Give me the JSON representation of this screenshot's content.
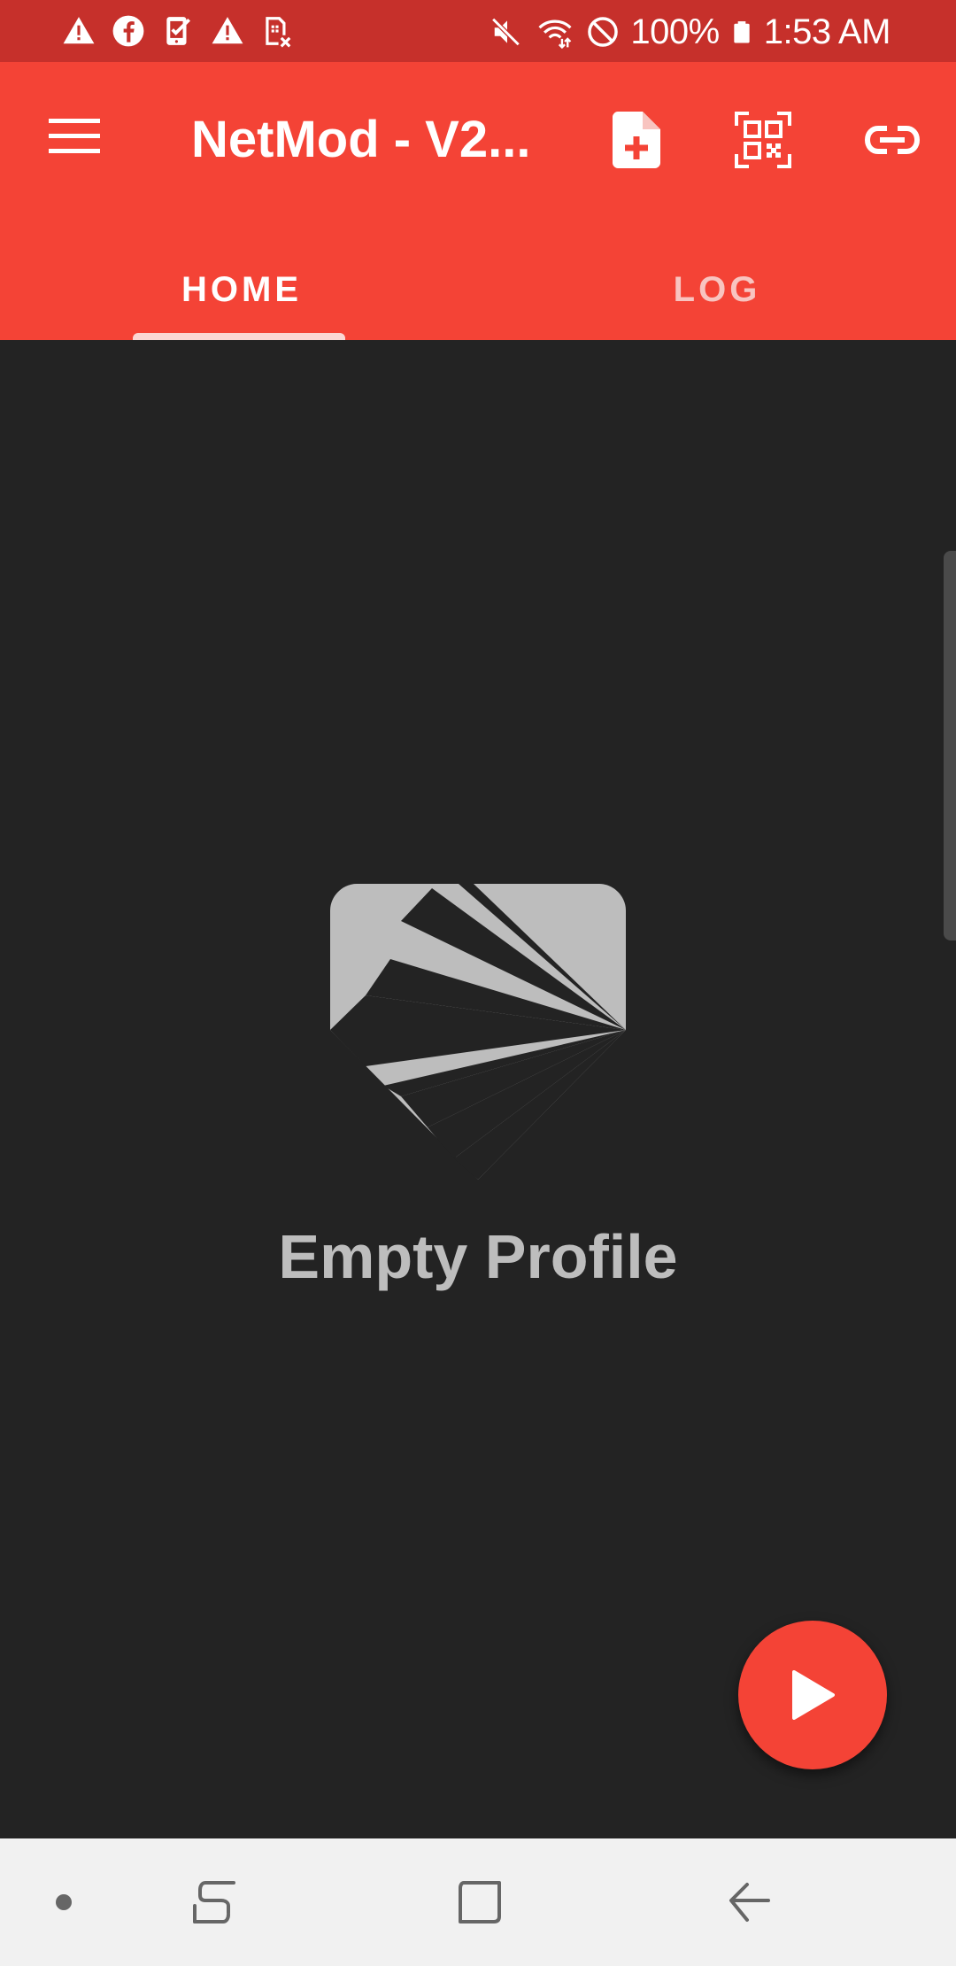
{
  "status_bar": {
    "battery": "100%",
    "time": "1:53 AM",
    "left_icons": [
      "warning-icon",
      "facebook-icon",
      "clipboard-check-icon",
      "warning-icon",
      "sim-off-icon"
    ],
    "right_icons": [
      "mute-icon",
      "wifi-icon",
      "do-not-disturb-icon",
      "battery-icon"
    ]
  },
  "app_bar": {
    "title": "NetMod - V2...",
    "menu_icon": "menu-icon",
    "actions": [
      {
        "name": "add-file",
        "icon": "file-plus-icon"
      },
      {
        "name": "qr-scan",
        "icon": "qr-code-icon"
      },
      {
        "name": "link",
        "icon": "link-icon"
      }
    ]
  },
  "tabs": [
    {
      "label": "HOME",
      "selected": true
    },
    {
      "label": "LOG",
      "selected": false
    }
  ],
  "main": {
    "empty_label": "Empty Profile",
    "logo_icon": "shield-rays-logo"
  },
  "fab": {
    "icon": "play-icon"
  },
  "nav_bar": {
    "buttons": [
      "dot-icon",
      "recents-icon",
      "home-icon",
      "back-icon"
    ]
  },
  "colors": {
    "status_bar": "#C6302B",
    "app_bar": "#F44336",
    "background": "#232323",
    "empty_text": "#BDBDBD",
    "nav_bar": "#F1F1F1"
  }
}
